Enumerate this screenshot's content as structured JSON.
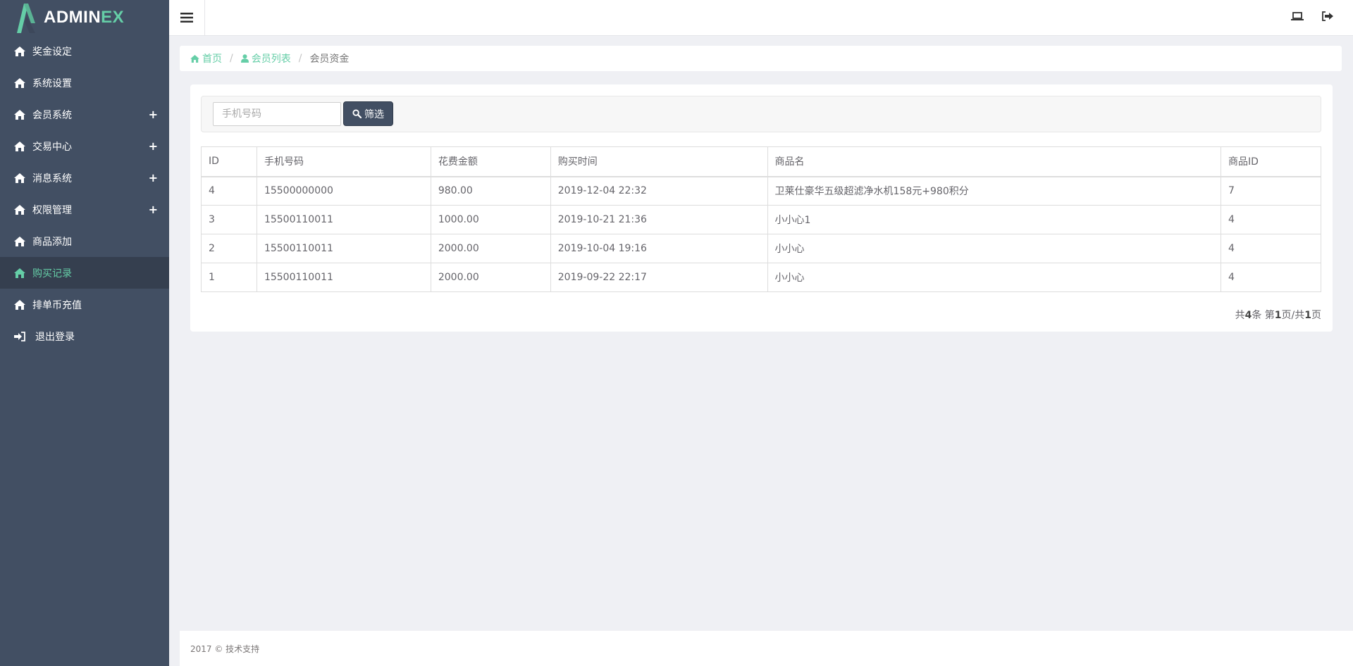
{
  "logo": {
    "part1": "ADMIN",
    "part2": "EX"
  },
  "sidebar": {
    "items": [
      {
        "label": "奖金设定",
        "icon": "home-icon",
        "expandable": false,
        "active": false
      },
      {
        "label": "系统设置",
        "icon": "home-icon",
        "expandable": false,
        "active": false
      },
      {
        "label": "会员系统",
        "icon": "home-icon",
        "expandable": true,
        "active": false
      },
      {
        "label": "交易中心",
        "icon": "home-icon",
        "expandable": true,
        "active": false
      },
      {
        "label": "消息系统",
        "icon": "home-icon",
        "expandable": true,
        "active": false
      },
      {
        "label": "权限管理",
        "icon": "home-icon",
        "expandable": true,
        "active": false
      },
      {
        "label": "商品添加",
        "icon": "home-icon",
        "expandable": false,
        "active": false
      },
      {
        "label": "购买记录",
        "icon": "home-icon",
        "expandable": false,
        "active": true
      },
      {
        "label": "排单币充值",
        "icon": "home-icon",
        "expandable": false,
        "active": false
      },
      {
        "label": "退出登录",
        "icon": "sign-in-icon",
        "expandable": false,
        "active": false
      }
    ],
    "expand_symbol": "+"
  },
  "header": {
    "toggle_icon": "hamburger-menu-icon",
    "right_icons": [
      "laptop-icon",
      "sign-out-icon"
    ]
  },
  "breadcrumb": {
    "home": "首页",
    "members": "会员列表",
    "current": "会员资金",
    "separator": "/"
  },
  "filter": {
    "placeholder": "手机号码",
    "value": "",
    "button_label": "筛选"
  },
  "table": {
    "headers": [
      "ID",
      "手机号码",
      "花费金额",
      "购买时间",
      "商品名",
      "商品ID"
    ],
    "rows": [
      [
        "4",
        "15500000000",
        "980.00",
        "2019-12-04 22:32",
        "卫莱仕豪华五级超滤净水机158元+980积分",
        "7"
      ],
      [
        "3",
        "15500110011",
        "1000.00",
        "2019-10-21 21:36",
        "小小心1",
        "4"
      ],
      [
        "2",
        "15500110011",
        "2000.00",
        "2019-10-04 19:16",
        "小小心",
        "4"
      ],
      [
        "1",
        "15500110011",
        "2000.00",
        "2019-09-22 22:17",
        "小小心",
        "4"
      ]
    ]
  },
  "pager": {
    "total_prefix": "共",
    "total": "4",
    "total_suffix": "条 第",
    "page": "1",
    "page_mid": "页/共",
    "pages": "1",
    "page_suffix": "页"
  },
  "footer": {
    "text": "2017 © 技术支持"
  },
  "colors": {
    "sidebar_bg": "#424f63",
    "sidebar_active_bg": "#353f4f",
    "accent": "#65cea7",
    "page_bg": "#eff0f4"
  }
}
